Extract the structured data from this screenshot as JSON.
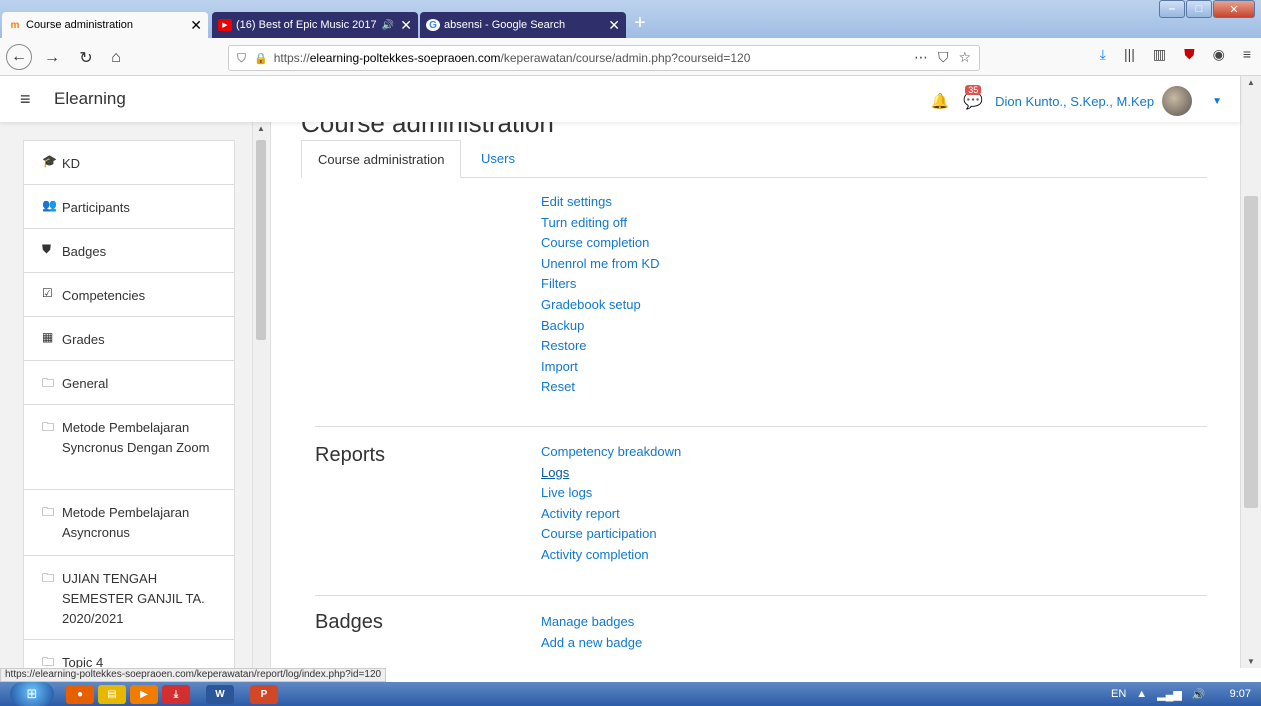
{
  "browser": {
    "tabs": [
      {
        "title": "Course administration",
        "favicon": "moodle-icon",
        "active": true
      },
      {
        "title": "(16) Best of Epic Music 2017",
        "favicon": "youtube-icon",
        "audio": "🔊",
        "active": false
      },
      {
        "title": "absensi - Google Search",
        "favicon": "google-icon",
        "active": false
      }
    ],
    "new_tab": "+",
    "url": {
      "prefix": "https://",
      "domain": "elearning-poltekkes-soepraoen.com",
      "path": "/keperawatan/course/admin.php?courseid=120"
    }
  },
  "moodle": {
    "brand": "Elearning",
    "notifications_badge": "35",
    "user_name": "Dion Kunto., S.Kep., M.Kep"
  },
  "sidebar": {
    "items": [
      {
        "icon": "graduation-cap-icon",
        "glyph": "🎓",
        "label": "KD"
      },
      {
        "icon": "users-icon",
        "glyph": "👥",
        "label": "Participants"
      },
      {
        "icon": "shield-icon",
        "glyph": "⛊",
        "label": "Badges"
      },
      {
        "icon": "check-square-icon",
        "glyph": "☑",
        "label": "Competencies"
      },
      {
        "icon": "table-icon",
        "glyph": "▦",
        "label": "Grades"
      },
      {
        "icon": "folder-icon",
        "glyph": "🗀",
        "label": "General"
      },
      {
        "icon": "folder-icon",
        "glyph": "🗀",
        "label": "Metode Pembelajaran Syncronus Dengan Zoom"
      },
      {
        "icon": "folder-icon",
        "glyph": "🗀",
        "label": "Metode Pembelajaran Asyncronus"
      },
      {
        "icon": "folder-icon",
        "glyph": "🗀",
        "label": "UJIAN TENGAH SEMESTER GANJIL TA. 2020/2021"
      },
      {
        "icon": "folder-icon",
        "glyph": "🗀",
        "label": "Topic 4"
      }
    ]
  },
  "main": {
    "page_title": "Course administration",
    "tabs": [
      {
        "label": "Course administration"
      },
      {
        "label": "Users"
      }
    ],
    "sections": [
      {
        "title": "",
        "links": [
          "Edit settings",
          "Turn editing off",
          "Course completion",
          "Unenrol me from KD",
          "Filters",
          "Gradebook setup",
          "Backup",
          "Restore",
          "Import",
          "Reset"
        ]
      },
      {
        "title": "Reports",
        "links": [
          "Competency breakdown",
          "Logs",
          "Live logs",
          "Activity report",
          "Course participation",
          "Activity completion"
        ]
      },
      {
        "title": "Badges",
        "links": [
          "Manage badges",
          "Add a new badge"
        ]
      }
    ]
  },
  "status_url": "https://elearning-poltekkes-soepraoen.com/keperawatan/report/log/index.php?id=120",
  "taskbar": {
    "language": "EN",
    "time": "9:07"
  },
  "colors": {
    "link": "#1177d1",
    "page_bg": "#f2f2f2",
    "badge": "#d9534f"
  }
}
